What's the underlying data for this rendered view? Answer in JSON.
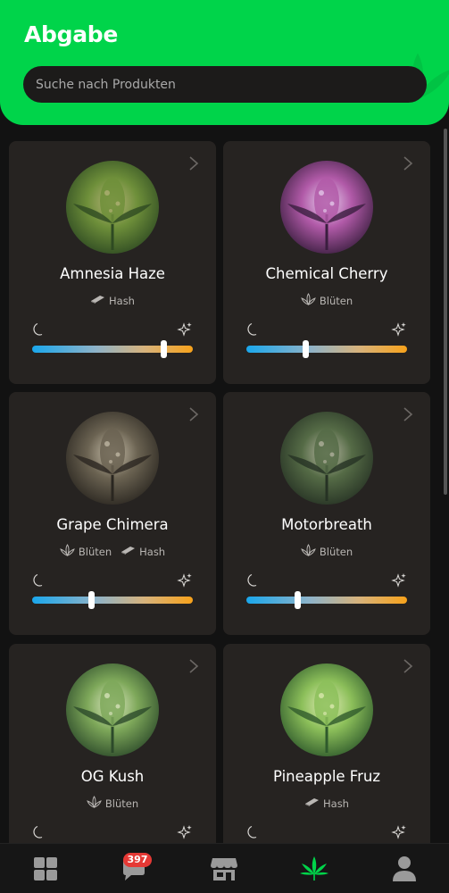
{
  "header": {
    "title": "Abgabe",
    "search_placeholder": "Suche nach Produkten"
  },
  "products": [
    {
      "name": "Amnesia Haze",
      "tags": [
        "Hash"
      ],
      "slider_value": 0.82
    },
    {
      "name": "Chemical Cherry",
      "tags": [
        "Blüten"
      ],
      "slider_value": 0.37
    },
    {
      "name": "Grape Chimera",
      "tags": [
        "Blüten",
        "Hash"
      ],
      "slider_value": 0.37
    },
    {
      "name": "Motorbreath",
      "tags": [
        "Blüten"
      ],
      "slider_value": 0.32
    },
    {
      "name": "OG Kush",
      "tags": [
        "Blüten"
      ],
      "slider_value": null
    },
    {
      "name": "Pineapple Fruz",
      "tags": [
        "Hash"
      ],
      "slider_value": null
    }
  ],
  "nav": {
    "items": [
      "dashboard-icon",
      "chat-icon",
      "store-icon",
      "cannabis-leaf-icon",
      "user-icon"
    ],
    "chat_badge": "397",
    "active": "cannabis-leaf-icon"
  },
  "colors": {
    "accent": "#00d44a",
    "background": "#121212",
    "card": "#262321",
    "slider_start": "#1aa7ec",
    "slider_end": "#f7a21b"
  }
}
